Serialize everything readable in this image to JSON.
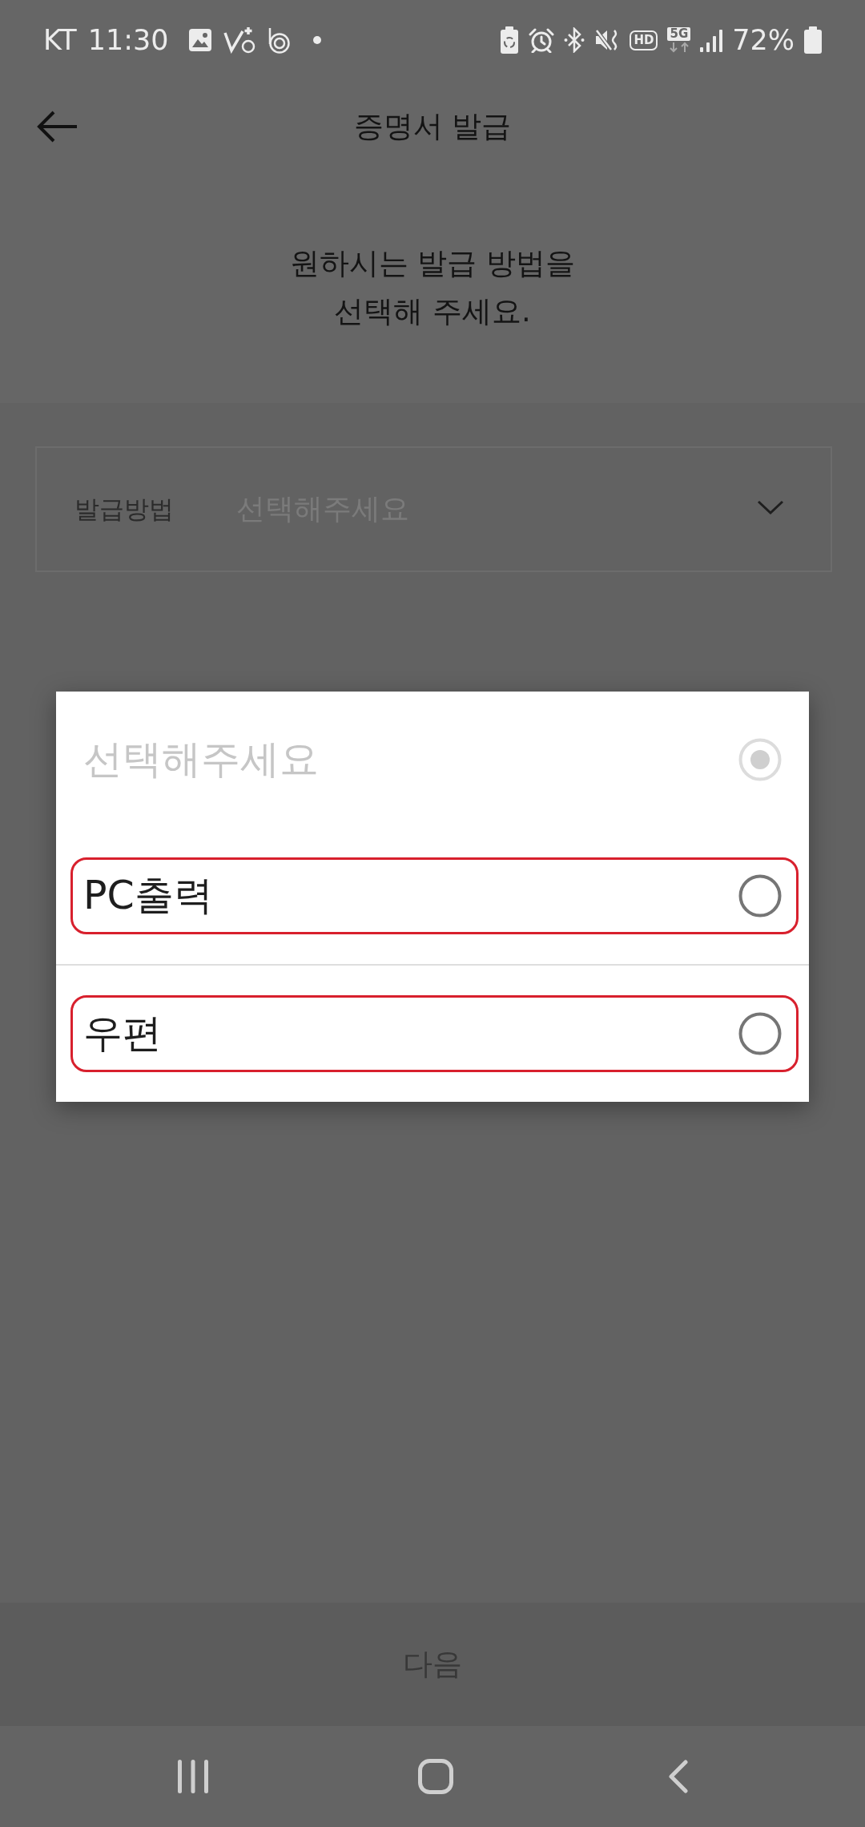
{
  "status_bar": {
    "carrier": "KT",
    "time": "11:30",
    "hd_label": "HD",
    "network": "5G",
    "battery": "72%"
  },
  "header": {
    "title": "증명서 발급"
  },
  "prompt": {
    "lines": [
      "원하시는 발급 방법을",
      "선택해 주세요."
    ]
  },
  "method_field": {
    "label": "발급방법",
    "placeholder": "선택해주세요"
  },
  "dialog": {
    "options": [
      {
        "label": "선택해주세요",
        "selected": true,
        "disabled": true,
        "highlighted": false
      },
      {
        "label": "PC출력",
        "selected": false,
        "disabled": false,
        "highlighted": true
      },
      {
        "label": "우편",
        "selected": false,
        "disabled": false,
        "highlighted": true
      }
    ]
  },
  "next_button": {
    "label": "다음"
  }
}
